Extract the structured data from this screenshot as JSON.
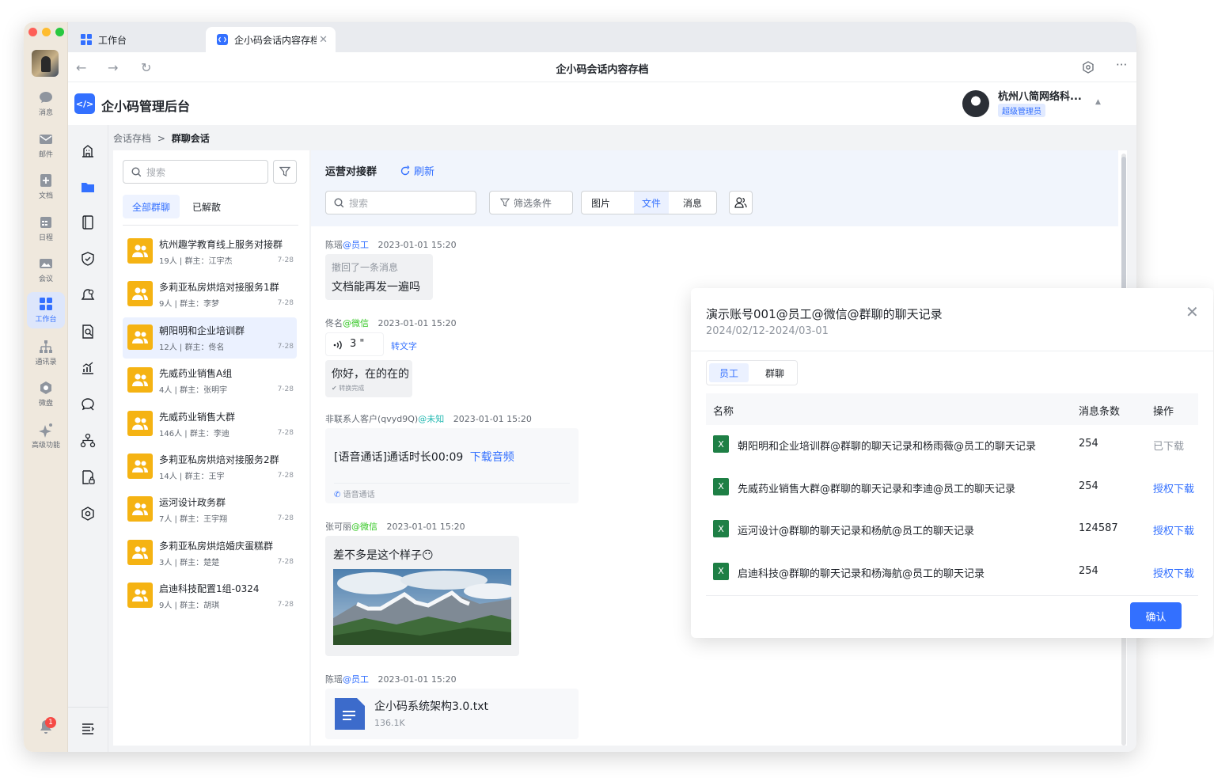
{
  "tabs": [
    {
      "label": "工作台",
      "active": false
    },
    {
      "label": "企小码会话内容存档",
      "active": true
    }
  ],
  "window_title": "企小码会话内容存档",
  "rail": {
    "items": [
      {
        "label": "消息",
        "icon": "chat-bubble-icon"
      },
      {
        "label": "邮件",
        "icon": "mail-icon"
      },
      {
        "label": "文档",
        "icon": "doc-icon"
      },
      {
        "label": "日程",
        "icon": "calendar-icon"
      },
      {
        "label": "会议",
        "icon": "meeting-icon"
      },
      {
        "label": "工作台",
        "icon": "grid-icon",
        "active": true
      },
      {
        "label": "通讯录",
        "icon": "org-chart-icon"
      },
      {
        "label": "微盘",
        "icon": "cloud-disk-icon"
      },
      {
        "label": "高级功能",
        "icon": "sparkle-icon"
      }
    ],
    "notification_badge": "1"
  },
  "app": {
    "name": "企小码管理后台",
    "logo_text": "</>"
  },
  "user": {
    "name": "杭州八简网络科...",
    "role": "超级管理员"
  },
  "breadcrumb": {
    "parent": "会话存档",
    "separator": ">",
    "current": "群聊会话"
  },
  "groups_panel": {
    "search_placeholder": "搜索",
    "tabs": [
      {
        "label": "全部群聊",
        "active": true
      },
      {
        "label": "已解散",
        "active": false
      }
    ],
    "items": [
      {
        "name": "杭州趣学教育线上服务对接群",
        "meta": "19人 | 群主：江宇杰",
        "date": "7-28"
      },
      {
        "name": "多莉亚私房烘焙对接服务1群",
        "meta": "9人 | 群主：李梦",
        "date": "7-28"
      },
      {
        "name": "朝阳明和企业培训群",
        "meta": "12人 | 群主：佟名",
        "date": "7-28",
        "active": true
      },
      {
        "name": "先威药业销售A组",
        "meta": "4人 | 群主：张明宇",
        "date": "7-28"
      },
      {
        "name": "先威药业销售大群",
        "meta": "146人 | 群主：李迪",
        "date": "7-28"
      },
      {
        "name": "多莉亚私房烘焙对接服务2群",
        "meta": "14人 | 群主：王宇",
        "date": "7-28"
      },
      {
        "name": "运河设计政务群",
        "meta": "7人 | 群主：王宇翔",
        "date": "7-28"
      },
      {
        "name": "多莉亚私房烘焙婚庆蛋糕群",
        "meta": "3人 | 群主：楚楚",
        "date": "7-28"
      },
      {
        "name": "启迪科技配置1组-0324",
        "meta": "9人 | 群主：胡琪",
        "date": "7-28"
      }
    ]
  },
  "chat": {
    "title": "运营对接群",
    "refresh_label": "刷新",
    "search_placeholder": "搜索",
    "filter_label": "筛选条件",
    "segments": [
      {
        "label": "图片",
        "active": false
      },
      {
        "label": "文件",
        "active": true
      },
      {
        "label": "消息",
        "active": false
      }
    ],
    "messages": [
      {
        "sender": "陈瑶",
        "tag": "@员工",
        "time": "2023-01-01 15:20",
        "recalled": "撤回了一条消息",
        "text": "文档能再发一遍吗"
      },
      {
        "sender": "佟名",
        "tag": "@微信",
        "time": "2023-01-01 15:20",
        "voice_duration": "3 \"",
        "convert_label": "转文字",
        "text": "你好，在的在的",
        "sub": "转换完成"
      },
      {
        "sender": "非联系人客户(qvyd9Q)",
        "tag": "@未知",
        "time": "2023-01-01 15:20",
        "call_text": "[语音通话]通话时长00:09",
        "call_link": "下载音频",
        "call_sub": "语音通话"
      },
      {
        "sender": "张可丽",
        "tag": "@微信",
        "time": "2023-01-01 15:20",
        "text": "差不多是这个样子😶"
      },
      {
        "sender": "陈瑶",
        "tag": "@员工",
        "time": "2023-01-01 15:20",
        "file_name": "企小码系统架构3.0.txt",
        "file_size": "136.1K"
      }
    ]
  },
  "modal": {
    "title": "演示账号001@员工@微信@群聊的聊天记录",
    "range": "2024/02/12-2024/03-01",
    "tabs": [
      {
        "label": "员工",
        "active": true
      },
      {
        "label": "群聊",
        "active": false
      }
    ],
    "columns": {
      "name": "名称",
      "count": "消息条数",
      "op": "操作"
    },
    "rows": [
      {
        "name": "朝阳明和企业培训群@群聊的聊天记录和杨雨薇@员工的聊天记录",
        "count": "254",
        "op": "已下载",
        "done": true
      },
      {
        "name": "先威药业销售大群@群聊的聊天记录和李迪@员工的聊天记录",
        "count": "254",
        "op": "授权下载"
      },
      {
        "name": "运河设计@群聊的聊天记录和杨航@员工的聊天记录",
        "count": "124587",
        "op": "授权下载"
      },
      {
        "name": "启迪科技@群聊的聊天记录和杨海航@员工的聊天记录",
        "count": "254",
        "op": "授权下载"
      }
    ],
    "file_icon_letter": "X",
    "confirm_label": "确认"
  },
  "colors": {
    "accent": "#3370ff",
    "group_icon": "#f5b313",
    "excel": "#1e7f45"
  }
}
